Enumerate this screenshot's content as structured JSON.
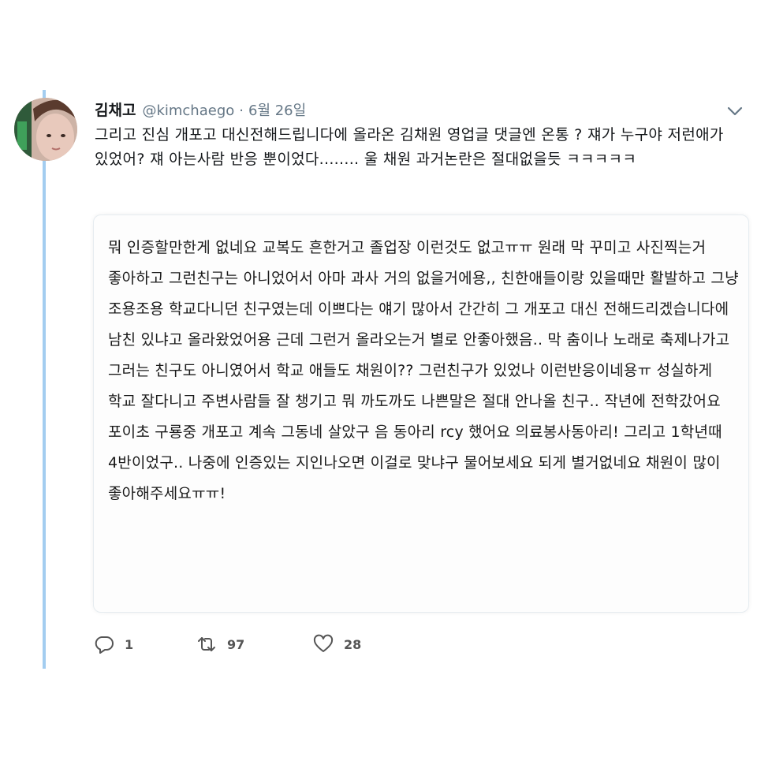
{
  "tweet": {
    "author_name": "김채고",
    "author_handle": "@kimchaego",
    "separator": "·",
    "date": "6월 26일",
    "text": "그리고 진심 개포고 대신전해드립니다에 올라온 김채원 영업글 댓글엔 온통 ? 쟤가 누구야 저런애가 있었어? 쟤 아는사람 반응 뿐이었다........ 울 채원 과거논란은 절대없을듯 ㅋㅋㅋㅋㅋ",
    "quoted_text": "뭐 인증할만한게 없네요 교복도 흔한거고 졸업장 이런것도 없고ㅠㅠ 원래 막 꾸미고 사진찍는거 좋아하고 그런친구는 아니었어서 아마 과사 거의 없을거에용,, 친한애들이랑 있을때만 활발하고 그냥 조용조용 학교다니던 친구였는데 이쁘다는 얘기 많아서 간간히 그 개포고 대신 전해드리겠습니다에 남친 있냐고 올라왔었어용 근데 그런거 올라오는거 별로 안좋아했음.. 막 춤이나 노래로 축제나가고 그러는 친구도 아니였어서 학교 애들도 채원이?? 그런친구가 있었나 이런반응이네용ㅠ 성실하게 학교 잘다니고 주변사람들 잘 챙기고 뭐 까도까도 나쁜말은 절대 안나올 친구.. 작년에 전학갔어요 포이초 구룡중 개포고 계속 그동네 살았구 음 동아리 rcy 했어요 의료봉사동아리! 그리고 1학년때 4반이었구.. 나중에 인증있는 지인나오면 이걸로 맞냐구 물어보세요 되게 별거없네요 채원이 많이 좋아해주세요ㅠㅠ!",
    "actions": {
      "reply_count": "1",
      "retweet_count": "97",
      "like_count": "28"
    }
  },
  "icons": {
    "reply": "reply-icon",
    "retweet": "retweet-icon",
    "like": "heart-icon",
    "menu": "chevron-down-icon"
  },
  "colors": {
    "thread_line": "#a3cdf0",
    "secondary_text": "#657786",
    "icon": "#555555"
  }
}
